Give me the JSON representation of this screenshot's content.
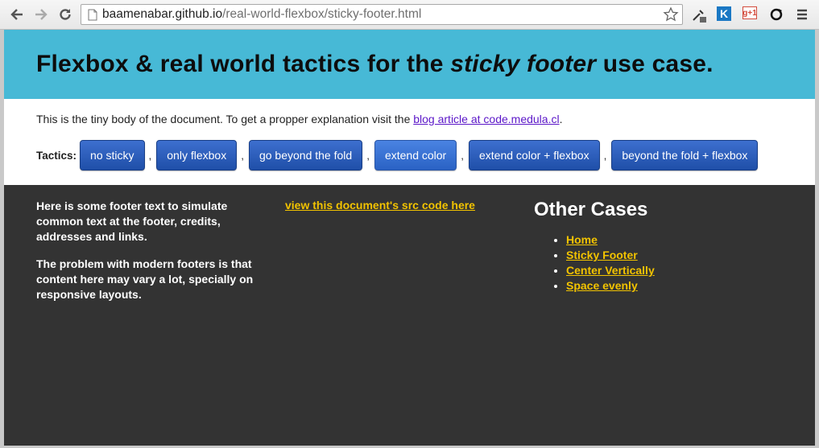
{
  "browser": {
    "url_host": "baamenabar.github.io",
    "url_path": "/real-world-flexbox/sticky-footer.html",
    "extension_k_label": "K",
    "extension_gplus_label": "g+1",
    "icons": [
      "back-icon",
      "forward-icon",
      "reload-icon",
      "page-icon",
      "star-icon",
      "eyedropper-icon",
      "k-extension-icon",
      "gplus-extension-icon",
      "sync-extension-icon",
      "menu-icon"
    ]
  },
  "header": {
    "title_prefix": "Flexbox & real world tactics for the ",
    "title_emphasis": "sticky footer",
    "title_suffix": " use case.",
    "bg_color": "#47b9d6"
  },
  "body": {
    "lead_text": "This is the tiny body of the document. To get a propper explanation visit the ",
    "lead_link": "blog article at code.medula.cl",
    "lead_end": ".",
    "tactics_label": "Tactics:",
    "separator": ",",
    "tactics": [
      {
        "label": "no sticky"
      },
      {
        "label": "only flexbox"
      },
      {
        "label": "go beyond the fold"
      },
      {
        "label": "extend color"
      },
      {
        "label": "extend color + flexbox"
      },
      {
        "label": "beyond the fold + flexbox"
      }
    ],
    "active_tactic": "extend color",
    "button_color": "#2a5bb8"
  },
  "footer": {
    "paragraph_1": "Here is some footer text to simulate common text at the footer, credits, addresses and links.",
    "paragraph_2": "The problem with modern footers is that content here may vary a lot, specially on responsive layouts.",
    "src_link": "view this document's src code here",
    "other_cases_title": "Other Cases",
    "other_cases": [
      "Home",
      "Sticky Footer",
      "Center Vertically",
      "Space evenly"
    ],
    "bg_color": "#333333",
    "link_color": "#f2c300"
  }
}
